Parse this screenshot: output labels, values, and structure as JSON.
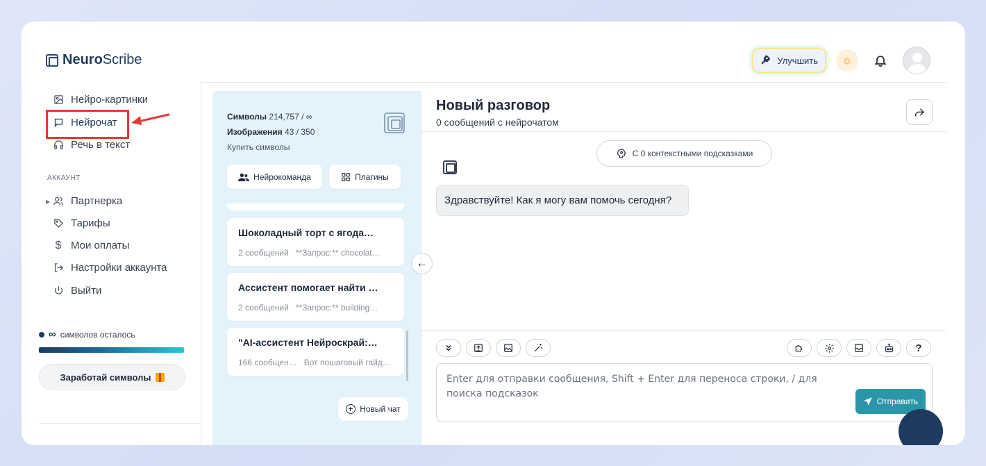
{
  "app": {
    "logo_bold": "Neuro",
    "logo_light": "Scribe"
  },
  "header": {
    "upgrade_label": "Улучшить"
  },
  "sidebar": {
    "items": [
      {
        "label": "Нейро-картинки",
        "icon": "image-icon"
      },
      {
        "label": "Нейрочат",
        "icon": "chat-icon",
        "active": true
      },
      {
        "label": "Речь в текст",
        "icon": "headphones-icon"
      }
    ],
    "account_section": "АККАУНТ",
    "account_items": [
      {
        "label": "Партнерка",
        "icon": "users-icon"
      },
      {
        "label": "Тарифы",
        "icon": "tag-icon"
      },
      {
        "label": "Мои оплаты",
        "icon": "dollar-icon"
      },
      {
        "label": "Настройки аккаунта",
        "icon": "logout-arrow-icon"
      },
      {
        "label": "Выйти",
        "icon": "power-icon"
      }
    ],
    "remaining": {
      "value": "∞",
      "label": "символов осталось"
    },
    "earn_label": "Заработай символы"
  },
  "chats_panel": {
    "symbols_label": "Символы",
    "symbols_value": "214,757 / ∞",
    "images_label": "Изображения",
    "images_value": "43 / 350",
    "buy_label": "Купить символы",
    "team_label": "Нейрокоманда",
    "plugins_label": "Плагины",
    "chats": [
      {
        "title": "Шоколадный торт с ягода…",
        "count": "2 сообщений",
        "preview": "**Запрос:** chocolat…"
      },
      {
        "title": "Ассистент помогает найти …",
        "count": "2 сообщений",
        "preview": "**Запрос:** building…"
      },
      {
        "title": "\"AI-ассистент Нейроскрай:…",
        "count": "166 сообщен…",
        "preview": "Вот пошаговый гайд…"
      }
    ],
    "new_chat_label": "Новый чат"
  },
  "conversation": {
    "title": "Новый разговор",
    "subtitle": "0 сообщений с нейрочатом",
    "context_label": "С 0 контекстными подсказками",
    "messages": [
      {
        "role": "assistant",
        "text": "Здравствуйте! Как я могу вам помочь сегодня?"
      }
    ],
    "input_placeholder": "Enter для отправки сообщения, Shift + Enter для переноса строки, / для поиска подсказок",
    "send_label": "Отправить",
    "help_label": "?"
  },
  "colors": {
    "accent": "#2a96a8",
    "brand": "#1e3a5f",
    "annotation": "#e53935"
  }
}
